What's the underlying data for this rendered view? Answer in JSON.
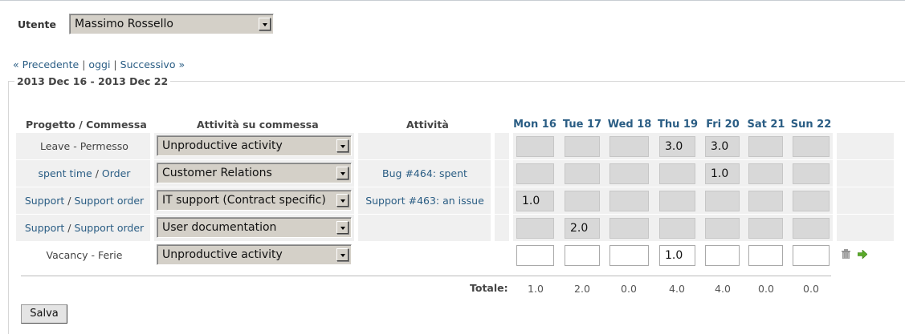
{
  "user": {
    "label": "Utente",
    "selected": "Massimo Rossello"
  },
  "nav": {
    "prev": "« Precedente",
    "today": "oggi",
    "next": "Successivo »",
    "sep": "|"
  },
  "week_label": "2013 Dec 16 - 2013 Dec 22",
  "headers": {
    "project": "Progetto / Commessa",
    "activity_order": "Attività su commessa",
    "activity": "Attività",
    "days": [
      "Mon 16",
      "Tue 17",
      "Wed 18",
      "Thu 19",
      "Fri 20",
      "Sat 21",
      "Sun 22"
    ]
  },
  "rows": [
    {
      "project": "Leave",
      "order": "Permesso",
      "project_link": false,
      "activity_type": "Unproductive activity",
      "issue": "",
      "hours": [
        "",
        "",
        "",
        "3.0",
        "3.0",
        "",
        ""
      ]
    },
    {
      "project": "spent time",
      "order": "Order",
      "project_link": true,
      "activity_type": "Customer Relations",
      "issue": "Bug #464: spent",
      "hours": [
        "",
        "",
        "",
        "",
        "1.0",
        "",
        ""
      ]
    },
    {
      "project": "Support",
      "order": "Support order",
      "project_link": true,
      "activity_type": "IT support (Contract specific)",
      "issue": "Support #463: an issue",
      "hours": [
        "1.0",
        "",
        "",
        "",
        "",
        "",
        ""
      ]
    },
    {
      "project": "Support",
      "order": "Support order",
      "project_link": true,
      "activity_type": "User documentation",
      "issue": "",
      "hours": [
        "",
        "2.0",
        "",
        "",
        "",
        "",
        ""
      ]
    },
    {
      "project": "Vacancy",
      "order": "Ferie",
      "project_link": false,
      "activity_type": "Unproductive activity",
      "issue": "",
      "hours": [
        "",
        "",
        "",
        "1.0",
        "",
        "",
        ""
      ],
      "editable": true
    }
  ],
  "totals": {
    "label": "Totale:",
    "values": [
      "1.0",
      "2.0",
      "0.0",
      "4.0",
      "4.0",
      "0.0",
      "0.0"
    ]
  },
  "save_label": "Salva",
  "icons": {
    "delete": "trash-icon",
    "add": "green-arrow-icon"
  }
}
